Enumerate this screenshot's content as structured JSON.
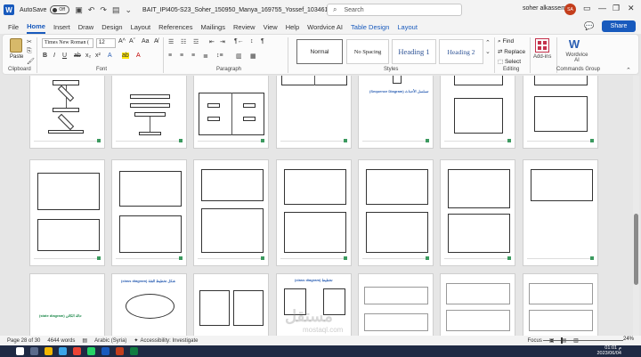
{
  "titlebar": {
    "autosave_label": "AutoSave",
    "autosave_state": "Off",
    "doc_title": "BAIT_IPI405-S23_Soher_150950_Manya_169755_Yossef_103461.docx • Saved",
    "search_placeholder": "Search",
    "user_name": "soher alkassem",
    "user_initials": "SA"
  },
  "tabs": [
    "File",
    "Home",
    "Insert",
    "Draw",
    "Design",
    "Layout",
    "References",
    "Mailings",
    "Review",
    "View",
    "Help",
    "Wordvice AI",
    "Table Design",
    "Layout"
  ],
  "active_tab": "Home",
  "share_label": "Share",
  "ribbon": {
    "paste_label": "Paste",
    "clipboard_label": "Clipboard",
    "font_name": "Times New Roman (",
    "font_size": "12",
    "font_label": "Font",
    "paragraph_label": "Paragraph",
    "styles": [
      "Normal",
      "No Spacing",
      "Heading 1",
      "Heading 2"
    ],
    "styles_label": "Styles",
    "find_label": "Find",
    "replace_label": "Replace",
    "select_label": "Select",
    "editing_label": "Editing",
    "addins_label": "Add-ins",
    "wordvice_label": "Wordvice AI",
    "commands_label": "Commands Group"
  },
  "pages": {
    "row1_caption": "(Sequence Diagram) تسلسل الأحداث",
    "row3_caption_left": "(state diagram) حالة الكائن",
    "row3_caption_2": "(class diagram) شكل تخطيط الفئة",
    "row3_caption_3": "(class diagram) تخطيط",
    "watermark": "mostaql.com"
  },
  "status": {
    "page": "Page 28 of 30",
    "words": "4644 words",
    "language": "Arabic (Syria)",
    "accessibility": "Accessibility: Investigate",
    "focus": "Focus",
    "zoom": "24%"
  },
  "taskbar": {
    "time": "01:01 م",
    "date": "2023/06/04"
  },
  "colors": {
    "accent": "#185abd",
    "share": "#185abd",
    "avatar": "#c43e1c",
    "page_title_red": "#c0392b",
    "green_text": "#1f8a4c"
  }
}
